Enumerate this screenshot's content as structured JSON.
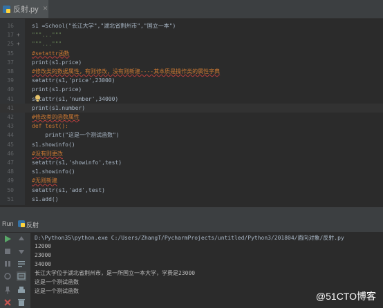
{
  "tab": {
    "label": "反射.py"
  },
  "editor": {
    "lines": [
      {
        "num": "16",
        "text": "s1 =School(\"长江大学\",\"湖北省荆州市\",\"国立一本\")",
        "cls": ""
      },
      {
        "num": "17",
        "text": "\"\"\"...\"\"\"",
        "cls": "str"
      },
      {
        "num": "25",
        "text": "\"\"\"...\"\"\"",
        "cls": "str"
      },
      {
        "num": "35",
        "text": "#setattr函数",
        "cls": "comment"
      },
      {
        "num": "37",
        "text": "print(s1.price)",
        "cls": ""
      },
      {
        "num": "38",
        "text": "#修改类的数据属性，有则修改，没有则新建----其本质是操作类的属性字典",
        "cls": "comment"
      },
      {
        "num": "39",
        "text": "setattr(s1,'price',23000)",
        "cls": ""
      },
      {
        "num": "40",
        "text": "print(s1.price)",
        "cls": ""
      },
      {
        "num": "41",
        "text": "setattr(s1,'number',34000)",
        "cls": ""
      },
      {
        "num": "41",
        "text": "print(s1.number)",
        "cls": ""
      },
      {
        "num": "42",
        "text": "#修改类的函数属性",
        "cls": "comment"
      },
      {
        "num": "43",
        "text": "def test():",
        "cls": "kw"
      },
      {
        "num": "44",
        "text": "    print(\"这是一个测试函数\")",
        "cls": ""
      },
      {
        "num": "45",
        "text": "s1.showinfo()",
        "cls": ""
      },
      {
        "num": "46",
        "text": "#没有则更改",
        "cls": "comment"
      },
      {
        "num": "47",
        "text": "setattr(s1,'showinfo',test)",
        "cls": ""
      },
      {
        "num": "48",
        "text": "s1.showinfo()",
        "cls": ""
      },
      {
        "num": "49",
        "text": "#无则新建",
        "cls": "comment"
      },
      {
        "num": "50",
        "text": "setattr(s1,'add',test)",
        "cls": ""
      },
      {
        "num": "51",
        "text": "s1.add()",
        "cls": ""
      }
    ]
  },
  "run": {
    "label": "Run",
    "config": "反射"
  },
  "console": {
    "lines": [
      "D:\\Python35\\python.exe C:/Users/ZhangT/PycharmProjects/untitled/Python3/201804/面向对象/反射.py",
      "12000",
      "23000",
      "34000",
      "长江大学位于湖北省荆州市，是一所国立一本大学，学费是23000",
      "这是一个测试函数",
      "这是一个测试函数"
    ]
  },
  "watermark": "@51CTO博客",
  "colors": {
    "background": "#2b2b2b",
    "comment": "#cc7832",
    "string": "#6a8759",
    "run_green": "#59a869"
  }
}
